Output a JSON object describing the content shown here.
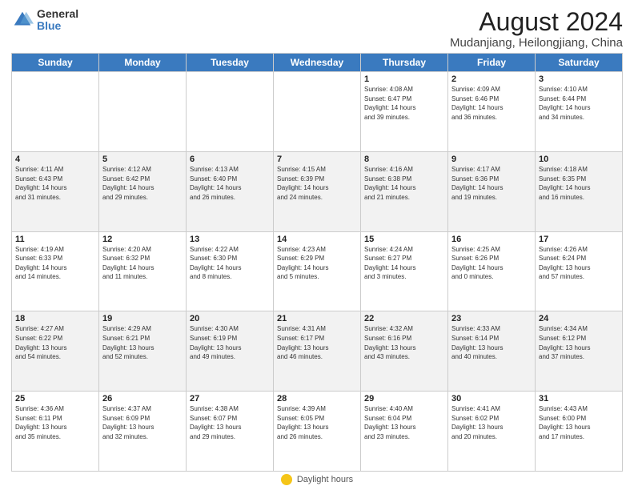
{
  "logo": {
    "general": "General",
    "blue": "Blue"
  },
  "title": "August 2024",
  "subtitle": "Mudanjiang, Heilongjiang, China",
  "days_of_week": [
    "Sunday",
    "Monday",
    "Tuesday",
    "Wednesday",
    "Thursday",
    "Friday",
    "Saturday"
  ],
  "footer_label": "Daylight hours",
  "weeks": [
    [
      {
        "day": "",
        "info": ""
      },
      {
        "day": "",
        "info": ""
      },
      {
        "day": "",
        "info": ""
      },
      {
        "day": "",
        "info": ""
      },
      {
        "day": "1",
        "info": "Sunrise: 4:08 AM\nSunset: 6:47 PM\nDaylight: 14 hours\nand 39 minutes."
      },
      {
        "day": "2",
        "info": "Sunrise: 4:09 AM\nSunset: 6:46 PM\nDaylight: 14 hours\nand 36 minutes."
      },
      {
        "day": "3",
        "info": "Sunrise: 4:10 AM\nSunset: 6:44 PM\nDaylight: 14 hours\nand 34 minutes."
      }
    ],
    [
      {
        "day": "4",
        "info": "Sunrise: 4:11 AM\nSunset: 6:43 PM\nDaylight: 14 hours\nand 31 minutes."
      },
      {
        "day": "5",
        "info": "Sunrise: 4:12 AM\nSunset: 6:42 PM\nDaylight: 14 hours\nand 29 minutes."
      },
      {
        "day": "6",
        "info": "Sunrise: 4:13 AM\nSunset: 6:40 PM\nDaylight: 14 hours\nand 26 minutes."
      },
      {
        "day": "7",
        "info": "Sunrise: 4:15 AM\nSunset: 6:39 PM\nDaylight: 14 hours\nand 24 minutes."
      },
      {
        "day": "8",
        "info": "Sunrise: 4:16 AM\nSunset: 6:38 PM\nDaylight: 14 hours\nand 21 minutes."
      },
      {
        "day": "9",
        "info": "Sunrise: 4:17 AM\nSunset: 6:36 PM\nDaylight: 14 hours\nand 19 minutes."
      },
      {
        "day": "10",
        "info": "Sunrise: 4:18 AM\nSunset: 6:35 PM\nDaylight: 14 hours\nand 16 minutes."
      }
    ],
    [
      {
        "day": "11",
        "info": "Sunrise: 4:19 AM\nSunset: 6:33 PM\nDaylight: 14 hours\nand 14 minutes."
      },
      {
        "day": "12",
        "info": "Sunrise: 4:20 AM\nSunset: 6:32 PM\nDaylight: 14 hours\nand 11 minutes."
      },
      {
        "day": "13",
        "info": "Sunrise: 4:22 AM\nSunset: 6:30 PM\nDaylight: 14 hours\nand 8 minutes."
      },
      {
        "day": "14",
        "info": "Sunrise: 4:23 AM\nSunset: 6:29 PM\nDaylight: 14 hours\nand 5 minutes."
      },
      {
        "day": "15",
        "info": "Sunrise: 4:24 AM\nSunset: 6:27 PM\nDaylight: 14 hours\nand 3 minutes."
      },
      {
        "day": "16",
        "info": "Sunrise: 4:25 AM\nSunset: 6:26 PM\nDaylight: 14 hours\nand 0 minutes."
      },
      {
        "day": "17",
        "info": "Sunrise: 4:26 AM\nSunset: 6:24 PM\nDaylight: 13 hours\nand 57 minutes."
      }
    ],
    [
      {
        "day": "18",
        "info": "Sunrise: 4:27 AM\nSunset: 6:22 PM\nDaylight: 13 hours\nand 54 minutes."
      },
      {
        "day": "19",
        "info": "Sunrise: 4:29 AM\nSunset: 6:21 PM\nDaylight: 13 hours\nand 52 minutes."
      },
      {
        "day": "20",
        "info": "Sunrise: 4:30 AM\nSunset: 6:19 PM\nDaylight: 13 hours\nand 49 minutes."
      },
      {
        "day": "21",
        "info": "Sunrise: 4:31 AM\nSunset: 6:17 PM\nDaylight: 13 hours\nand 46 minutes."
      },
      {
        "day": "22",
        "info": "Sunrise: 4:32 AM\nSunset: 6:16 PM\nDaylight: 13 hours\nand 43 minutes."
      },
      {
        "day": "23",
        "info": "Sunrise: 4:33 AM\nSunset: 6:14 PM\nDaylight: 13 hours\nand 40 minutes."
      },
      {
        "day": "24",
        "info": "Sunrise: 4:34 AM\nSunset: 6:12 PM\nDaylight: 13 hours\nand 37 minutes."
      }
    ],
    [
      {
        "day": "25",
        "info": "Sunrise: 4:36 AM\nSunset: 6:11 PM\nDaylight: 13 hours\nand 35 minutes."
      },
      {
        "day": "26",
        "info": "Sunrise: 4:37 AM\nSunset: 6:09 PM\nDaylight: 13 hours\nand 32 minutes."
      },
      {
        "day": "27",
        "info": "Sunrise: 4:38 AM\nSunset: 6:07 PM\nDaylight: 13 hours\nand 29 minutes."
      },
      {
        "day": "28",
        "info": "Sunrise: 4:39 AM\nSunset: 6:05 PM\nDaylight: 13 hours\nand 26 minutes."
      },
      {
        "day": "29",
        "info": "Sunrise: 4:40 AM\nSunset: 6:04 PM\nDaylight: 13 hours\nand 23 minutes."
      },
      {
        "day": "30",
        "info": "Sunrise: 4:41 AM\nSunset: 6:02 PM\nDaylight: 13 hours\nand 20 minutes."
      },
      {
        "day": "31",
        "info": "Sunrise: 4:43 AM\nSunset: 6:00 PM\nDaylight: 13 hours\nand 17 minutes."
      }
    ]
  ]
}
